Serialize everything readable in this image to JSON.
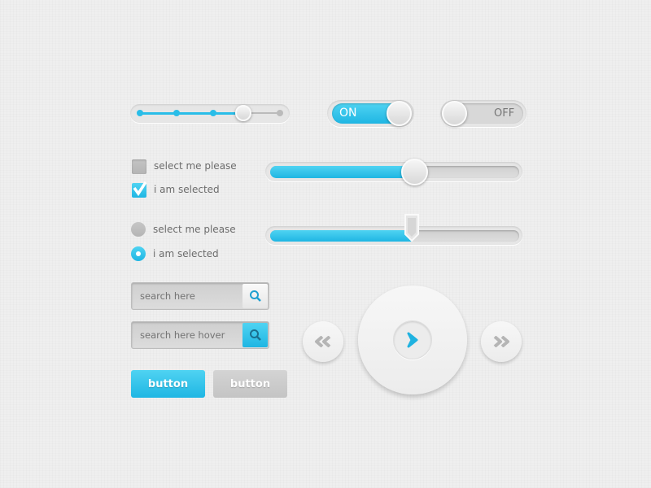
{
  "colors": {
    "accent": "#29bde8",
    "background": "#efefef",
    "knob": "#e2e2e2"
  },
  "step_slider": {
    "steps": 5,
    "selected_step": 4
  },
  "toggles": [
    {
      "label": "ON",
      "state": true
    },
    {
      "label": "OFF",
      "state": false
    }
  ],
  "checkboxes": [
    {
      "label": "select me please",
      "checked": false
    },
    {
      "label": "i am selected",
      "checked": true
    }
  ],
  "radios": [
    {
      "label": "select me please",
      "selected": false
    },
    {
      "label": "i am selected",
      "selected": true
    }
  ],
  "sliders": [
    {
      "value_percent": 58,
      "handle": "round"
    },
    {
      "value_percent": 57,
      "handle": "pointer"
    }
  ],
  "search": [
    {
      "placeholder": "search here",
      "icon": "search-icon"
    },
    {
      "placeholder": "search here hover",
      "icon": "search-icon"
    }
  ],
  "buttons": [
    {
      "label": "button",
      "style": "primary"
    },
    {
      "label": "button",
      "style": "secondary"
    }
  ],
  "media": {
    "prev_icon": "rewind-icon",
    "play_icon": "play-icon",
    "next_icon": "fast-forward-icon"
  }
}
